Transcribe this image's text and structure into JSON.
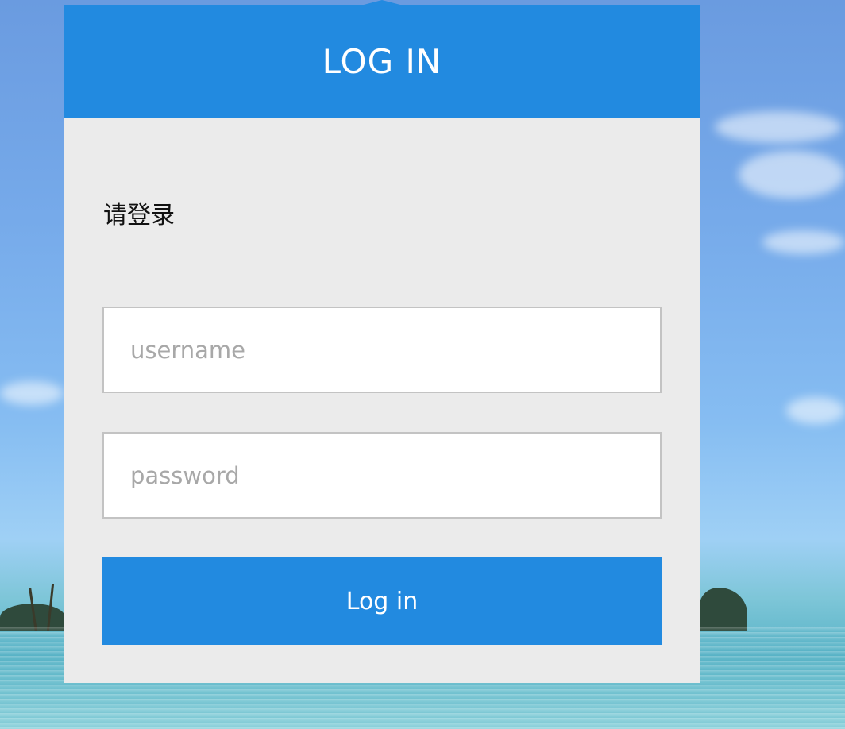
{
  "header": {
    "title": "LOG IN",
    "accent_color": "#228ae0"
  },
  "form": {
    "prompt": "请登录",
    "username": {
      "value": "",
      "placeholder": "username"
    },
    "password": {
      "value": "",
      "placeholder": "password"
    },
    "submit_label": "Log in"
  },
  "colors": {
    "card_background": "#ebebeb",
    "field_border": "#c3c3c3",
    "placeholder_text": "#a8a8a8"
  },
  "background": {
    "scene": "tropical-sky-and-sea"
  }
}
